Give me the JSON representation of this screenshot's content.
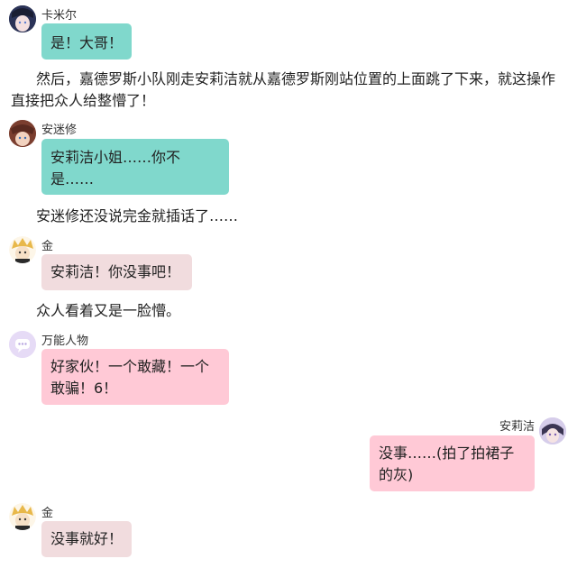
{
  "messages": [
    {
      "speaker": "卡米尔",
      "text": "是！大哥！",
      "avatar": "camille-avatar"
    },
    {
      "narration": "然后，嘉德罗斯小队刚走安莉洁就从嘉德罗斯刚站位置的上面跳了下来，就这操作直接把众人给整懵了！"
    },
    {
      "speaker": "安迷修",
      "text": "安莉洁小姐……你不是……",
      "avatar": "anmixiu-avatar"
    },
    {
      "narration": "安迷修还没说完金就插话了……"
    },
    {
      "speaker": "金",
      "text": "安莉洁！你没事吧！",
      "avatar": "jin-avatar"
    },
    {
      "narration": "众人看着又是一脸懵。"
    },
    {
      "speaker": "万能人物",
      "text": "好家伙！一个敢藏！一个敢骗！6！",
      "avatar": "chat-bubble-avatar"
    },
    {
      "speaker": "安莉洁",
      "text": "没事……(拍了拍裙子的灰)",
      "avatar": "anlijie-avatar"
    },
    {
      "speaker": "金",
      "text": "没事就好！",
      "avatar": "jin-avatar"
    }
  ],
  "colors": {
    "teal_bubble": "#80d8cc",
    "grey_bubble": "#f1dcde",
    "pink_bubble": "#ffc9d6"
  }
}
